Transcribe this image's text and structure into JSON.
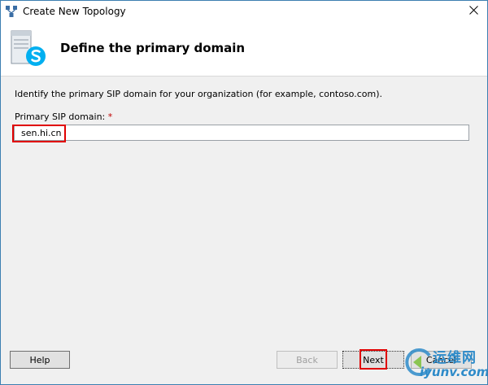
{
  "window": {
    "title": "Create New Topology",
    "close_glyph": "✕",
    "app_icon": "topology-icon"
  },
  "header": {
    "title": "Define the primary domain",
    "icon": "skype-server-icon"
  },
  "content": {
    "description": "Identify the primary SIP domain for your organization (for example, contoso.com).",
    "field_label": "Primary SIP domain:",
    "required_mark": "*",
    "sip_domain_value": "sen.hi.cn"
  },
  "buttons": {
    "help": "Help",
    "back": "Back",
    "next": "Next",
    "cancel": "Cancel"
  },
  "watermark": {
    "cn": "运维网",
    "en": "iyunv.com"
  },
  "colors": {
    "window_border": "#3c7fb1",
    "highlight": "#e00000",
    "skype_blue": "#00aff0",
    "watermark": "#2e8bc9"
  }
}
